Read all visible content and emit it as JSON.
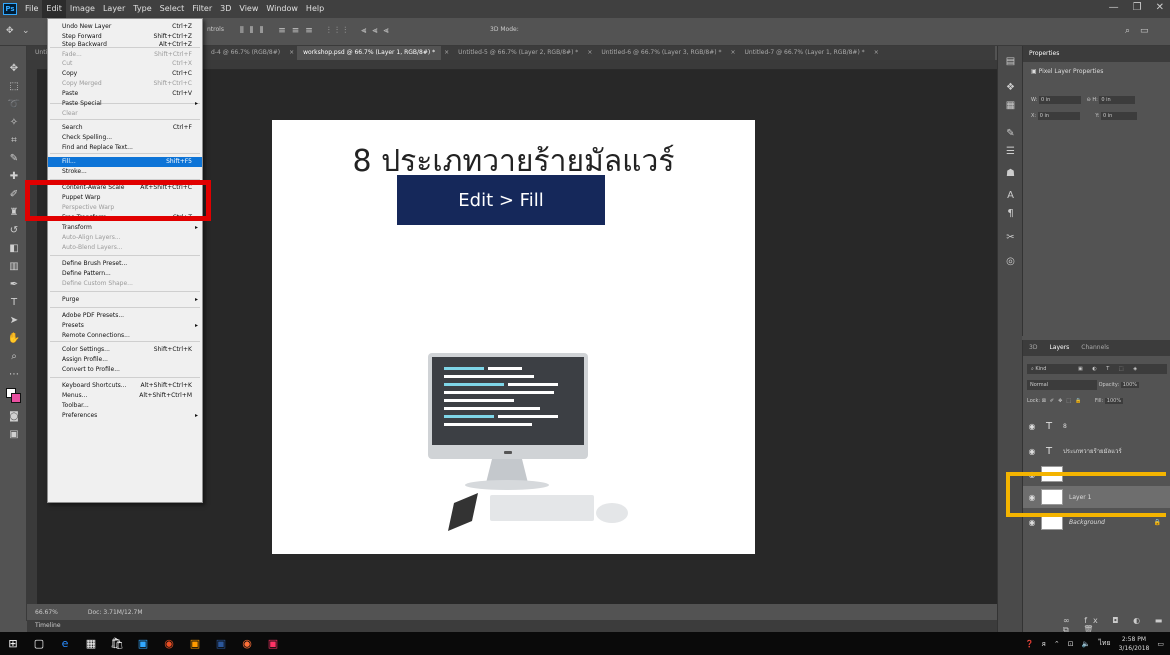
{
  "menubar": {
    "items": [
      "File",
      "Edit",
      "Image",
      "Layer",
      "Type",
      "Select",
      "Filter",
      "3D",
      "View",
      "Window",
      "Help"
    ],
    "active": "Edit"
  },
  "tabs": [
    "d-4 @ 66.7% (RGB/8#)",
    "workshop.psd @ 66.7% (Layer 1, RGB/8#) *",
    "Untitled-5 @ 66.7% (Layer 2, RGB/8#) *",
    "Untitled-6 @ 66.7% (Layer 3, RGB/8#) *",
    "Untitled-7 @ 66.7% (Layer 1, RGB/8#) *"
  ],
  "tab_partial": "Unti",
  "options_bar": {
    "label": "ntrols",
    "mode_3d": "3D Mode:"
  },
  "edit_menu": {
    "items": [
      {
        "label": "Undo New Layer",
        "shortcut": "Ctrl+Z",
        "state": "normal"
      },
      {
        "label": "Step Forward",
        "shortcut": "Shift+Ctrl+Z",
        "state": "normal"
      },
      {
        "label": "Step Backward",
        "shortcut": "Alt+Ctrl+Z",
        "state": "normal"
      },
      {
        "label": "Fade...",
        "shortcut": "Shift+Ctrl+F",
        "state": "disabled"
      },
      {
        "label": "Cut",
        "shortcut": "Ctrl+X",
        "state": "disabled"
      },
      {
        "label": "Copy",
        "shortcut": "Ctrl+C",
        "state": "normal"
      },
      {
        "label": "Copy Merged",
        "shortcut": "Shift+Ctrl+C",
        "state": "disabled"
      },
      {
        "label": "Paste",
        "shortcut": "Ctrl+V",
        "state": "normal"
      },
      {
        "label": "Paste Special",
        "shortcut": "",
        "state": "submenu"
      },
      {
        "label": "Clear",
        "shortcut": "",
        "state": "disabled"
      },
      {
        "label": "Search",
        "shortcut": "Ctrl+F",
        "state": "normal"
      },
      {
        "label": "Check Spelling...",
        "shortcut": "",
        "state": "normal"
      },
      {
        "label": "Find and Replace Text...",
        "shortcut": "",
        "state": "normal"
      },
      {
        "label": "Fill...",
        "shortcut": "Shift+F5",
        "state": "highlighted"
      },
      {
        "label": "Stroke...",
        "shortcut": "",
        "state": "normal"
      },
      {
        "label": "Content-Aware Scale",
        "shortcut": "Alt+Shift+Ctrl+C",
        "state": "normal"
      },
      {
        "label": "Puppet Warp",
        "shortcut": "",
        "state": "normal"
      },
      {
        "label": "Perspective Warp",
        "shortcut": "",
        "state": "disabled"
      },
      {
        "label": "Free Transform",
        "shortcut": "Ctrl+T",
        "state": "normal"
      },
      {
        "label": "Transform",
        "shortcut": "",
        "state": "submenu"
      },
      {
        "label": "Auto-Align Layers...",
        "shortcut": "",
        "state": "disabled"
      },
      {
        "label": "Auto-Blend Layers...",
        "shortcut": "",
        "state": "disabled"
      },
      {
        "label": "Define Brush Preset...",
        "shortcut": "",
        "state": "normal"
      },
      {
        "label": "Define Pattern...",
        "shortcut": "",
        "state": "normal"
      },
      {
        "label": "Define Custom Shape...",
        "shortcut": "",
        "state": "disabled"
      },
      {
        "label": "Purge",
        "shortcut": "",
        "state": "submenu"
      },
      {
        "label": "Adobe PDF Presets...",
        "shortcut": "",
        "state": "normal"
      },
      {
        "label": "Presets",
        "shortcut": "",
        "state": "submenu"
      },
      {
        "label": "Remote Connections...",
        "shortcut": "",
        "state": "normal"
      },
      {
        "label": "Color Settings...",
        "shortcut": "Shift+Ctrl+K",
        "state": "normal"
      },
      {
        "label": "Assign Profile...",
        "shortcut": "",
        "state": "normal"
      },
      {
        "label": "Convert to Profile...",
        "shortcut": "",
        "state": "normal"
      },
      {
        "label": "Keyboard Shortcuts...",
        "shortcut": "Alt+Shift+Ctrl+K",
        "state": "normal"
      },
      {
        "label": "Menus...",
        "shortcut": "Alt+Shift+Ctrl+M",
        "state": "normal"
      },
      {
        "label": "Toolbar...",
        "shortcut": "",
        "state": "normal"
      },
      {
        "label": "Preferences",
        "shortcut": "",
        "state": "submenu"
      }
    ]
  },
  "document": {
    "title": "8 ประเภทวายร้ายมัลแวร์",
    "banner": "Edit > Fill",
    "banner_color": "#15285a"
  },
  "status": {
    "zoom": "66.67%",
    "doc": "Doc: 3.71M/12.7M"
  },
  "timeline_label": "Timeline",
  "properties": {
    "tab": "Properties",
    "subtitle": "Pixel Layer Properties",
    "w_label": "W:",
    "w_value": "0 in",
    "h_label": "H:",
    "h_value": "0 in",
    "x_label": "X:",
    "x_value": "0 in",
    "y_label": "Y:",
    "y_value": "0 in"
  },
  "layers_panel": {
    "tabs": [
      "3D",
      "Layers",
      "Channels"
    ],
    "kind": "Kind",
    "blend": "Normal",
    "opacity_label": "Opacity:",
    "opacity": "100%",
    "lock_label": "Lock:",
    "fill_label": "Fill:",
    "fill": "100%",
    "layers": [
      {
        "name": "8",
        "type": "text"
      },
      {
        "name": "ประเภทวายร้ายมัลแวร์",
        "type": "text"
      },
      {
        "name": "",
        "type": "image"
      },
      {
        "name": "Layer 1",
        "type": "empty",
        "selected": true
      },
      {
        "name": "Background",
        "type": "background"
      }
    ]
  },
  "taskbar": {
    "time": "2:58 PM",
    "date": "3/16/2018",
    "lang": "ไทย"
  },
  "highlight_colors": {
    "red": "#e10000",
    "yellow": "#f4b400"
  }
}
